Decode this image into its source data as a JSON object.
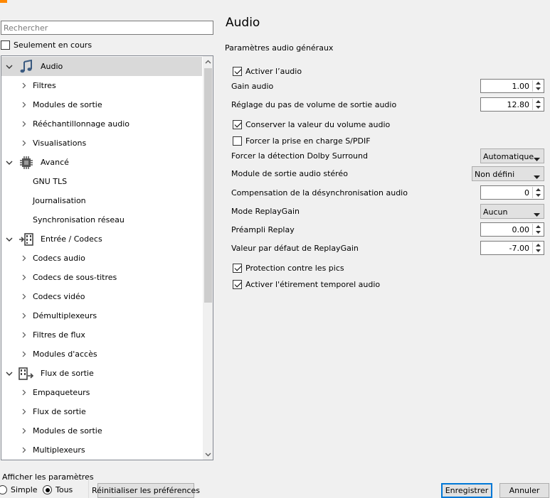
{
  "search": {
    "placeholder": "Rechercher"
  },
  "only_current": {
    "label": "Seulement en cours",
    "checked": false
  },
  "tree": [
    {
      "label": "Audio",
      "level": 0,
      "expanded": true,
      "selected": true,
      "icon": "music-note-icon"
    },
    {
      "label": "Filtres",
      "level": 1,
      "has_children": true
    },
    {
      "label": "Modules de sortie",
      "level": 1,
      "has_children": true
    },
    {
      "label": "Rééchantillonnage audio",
      "level": 1,
      "has_children": true
    },
    {
      "label": "Visualisations",
      "level": 1,
      "has_children": true
    },
    {
      "label": "Avancé",
      "level": 0,
      "expanded": true,
      "icon": "cpu-chip-icon"
    },
    {
      "label": "GNU TLS",
      "level": 1,
      "has_children": false
    },
    {
      "label": "Journalisation",
      "level": 1,
      "has_children": false
    },
    {
      "label": "Synchronisation réseau",
      "level": 1,
      "has_children": false
    },
    {
      "label": "Entrée / Codecs",
      "level": 0,
      "expanded": true,
      "icon": "input-codec-icon"
    },
    {
      "label": "Codecs audio",
      "level": 1,
      "has_children": true
    },
    {
      "label": "Codecs de sous-titres",
      "level": 1,
      "has_children": true
    },
    {
      "label": "Codecs vidéo",
      "level": 1,
      "has_children": true
    },
    {
      "label": "Démultiplexeurs",
      "level": 1,
      "has_children": true
    },
    {
      "label": "Filtres de flux",
      "level": 1,
      "has_children": true
    },
    {
      "label": "Modules d'accès",
      "level": 1,
      "has_children": true
    },
    {
      "label": "Flux de sortie",
      "level": 0,
      "expanded": true,
      "icon": "stream-output-icon"
    },
    {
      "label": "Empaqueteurs",
      "level": 1,
      "has_children": true
    },
    {
      "label": "Flux de sortie",
      "level": 1,
      "has_children": true
    },
    {
      "label": "Modules de sortie",
      "level": 1,
      "has_children": true
    },
    {
      "label": "Multiplexeurs",
      "level": 1,
      "has_children": true
    }
  ],
  "panel": {
    "title": "Audio",
    "section": "Paramètres audio généraux",
    "fields": [
      {
        "type": "check",
        "label": "Activer l’audio",
        "checked": true
      },
      {
        "type": "spin",
        "label": "Gain audio",
        "value": "1.00"
      },
      {
        "type": "spin",
        "label": "Réglage du pas de volume de sortie audio",
        "value": "12.80"
      },
      {
        "type": "check",
        "label": "Conserver la valeur du volume audio",
        "checked": true
      },
      {
        "type": "check",
        "label": "Forcer la prise en charge S/PDIF",
        "checked": false
      },
      {
        "type": "combo",
        "label": "Forcer la détection Dolby Surround",
        "value": "Automatique"
      },
      {
        "type": "combo",
        "label": "Module de sortie audio stéréo",
        "value": "Non défini",
        "wide": true
      },
      {
        "type": "spin",
        "label": "Compensation de la désynchronisation audio",
        "value": "0"
      },
      {
        "type": "combo",
        "label": "Mode ReplayGain",
        "value": "Aucun"
      },
      {
        "type": "spin",
        "label": "Préampli Replay",
        "value": "0.00"
      },
      {
        "type": "spin",
        "label": "Valeur par défaut de ReplayGain",
        "value": "-7.00"
      },
      {
        "type": "check",
        "label": "Protection contre les pics",
        "checked": true
      },
      {
        "type": "check",
        "label": "Activer l'étirement temporel audio",
        "checked": true
      }
    ]
  },
  "footer": {
    "show_settings_label": "Afficher les paramètres",
    "simple_label": "Simple",
    "all_label": "Tous",
    "selected_mode": "all",
    "reset_label": "Réinitialiser les préférences",
    "save_label": "Enregistrer",
    "cancel_label": "Annuler"
  }
}
